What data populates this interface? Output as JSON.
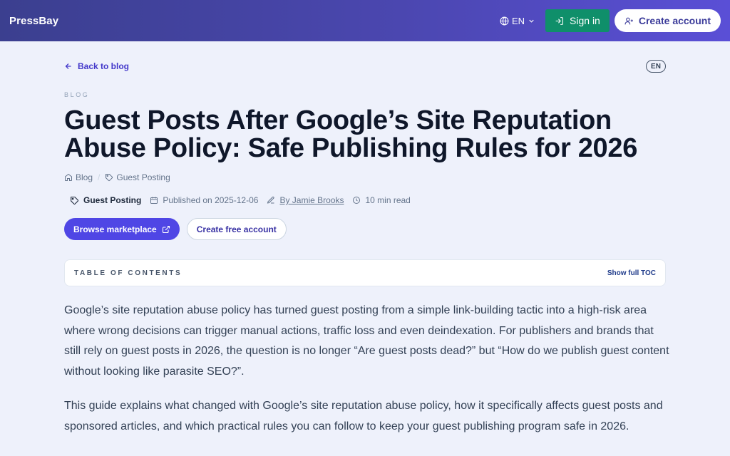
{
  "header": {
    "brand": "PressBay",
    "language": "EN",
    "sign_in": "Sign in",
    "create_account": "Create account",
    "colors": {
      "gradient_start": "#3b3f8f",
      "gradient_end": "#5a4fd6",
      "sign_in_bg": "#0f8f6a"
    }
  },
  "article": {
    "back_label": "Back to blog",
    "language_badge": "EN",
    "eyebrow": "BLOG",
    "title": "Guest Posts After Google’s Site Reputation Abuse Policy: Safe Publishing Rules for 2026",
    "breadcrumbs": [
      "Blog",
      "Guest Posting"
    ],
    "meta": {
      "category": "Guest Posting",
      "published": "Published on 2025-12-06",
      "author": "By Jamie Brooks",
      "read_time": "10 min read"
    },
    "actions": {
      "browse": "Browse marketplace",
      "create_free": "Create free account"
    },
    "toc": {
      "label": "TABLE OF CONTENTS",
      "link": "Show full TOC"
    },
    "paragraphs": [
      "Google’s site reputation abuse policy has turned guest posting from a simple link-building tactic into a high-risk area where wrong decisions can trigger manual actions, traffic loss and even deindexation. For publishers and brands that still rely on guest posts in 2026, the question is no longer “Are guest posts dead?” but “How do we publish guest content without looking like parasite SEO?”.",
      "This guide explains what changed with Google’s site reputation abuse policy, how it specifically affects guest posts and sponsored articles, and which practical rules you can follow to keep your guest publishing program safe in 2026."
    ]
  },
  "icons": [
    "globe-icon",
    "chevron-down-icon",
    "sign-in-icon",
    "user-plus-icon",
    "arrow-left-icon",
    "home-icon",
    "tag-icon",
    "calendar-icon",
    "pen-icon",
    "clock-icon",
    "external-link-icon"
  ]
}
